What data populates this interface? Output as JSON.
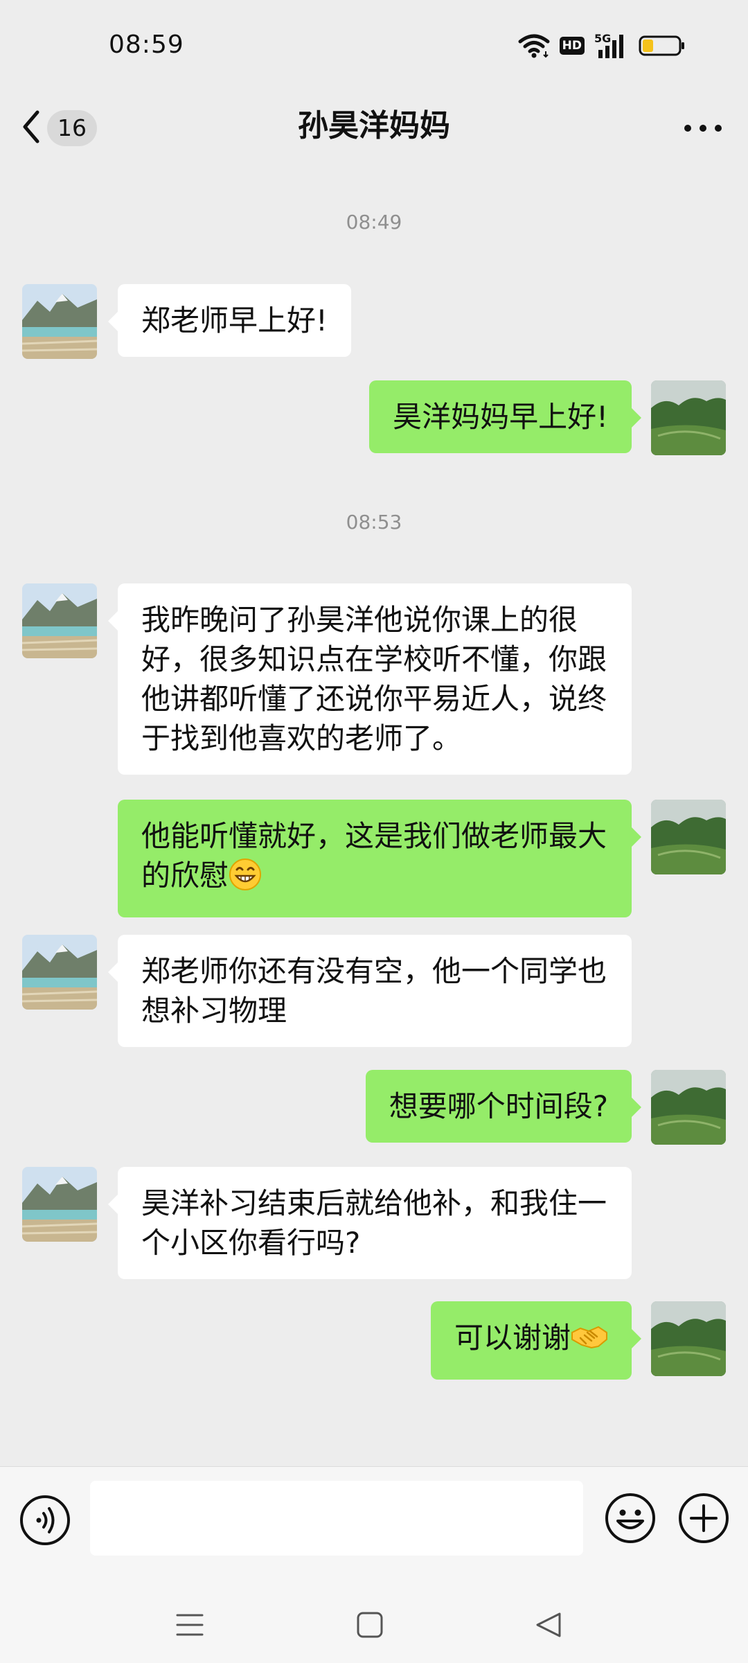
{
  "status_bar": {
    "time": "08:59",
    "icons": [
      "wifi-icon",
      "hd-icon",
      "signal-5g-icon",
      "battery-icon"
    ],
    "network_label": "5G",
    "hd_label": "HD",
    "battery_level": 0.3
  },
  "header": {
    "back_count": "16",
    "title": "孙昊洋妈妈"
  },
  "messages": [
    {
      "type": "timestamp",
      "text": "08:49"
    },
    {
      "type": "in",
      "text": "郑老师早上好!"
    },
    {
      "type": "out",
      "text": "昊洋妈妈早上好!"
    },
    {
      "type": "timestamp",
      "text": "08:53"
    },
    {
      "type": "in",
      "text": "我昨晚问了孙昊洋他说你课上的很好，很多知识点在学校听不懂，你跟他讲都听懂了还说你平易近人，说终于找到他喜欢的老师了。"
    },
    {
      "type": "out",
      "text": "他能听懂就好，这是我们做老师最大的欣慰",
      "emoji": "grinning-face-emoji"
    },
    {
      "type": "in",
      "text": "郑老师你还有没有空，他一个同学也想补习物理"
    },
    {
      "type": "out",
      "text": "想要哪个时间段?"
    },
    {
      "type": "in",
      "text": "昊洋补习结束后就给他补，和我住一个小区你看行吗?"
    },
    {
      "type": "out",
      "text": "可以谢谢",
      "emoji": "handshake-emoji"
    }
  ],
  "input_bar": {
    "placeholder": "",
    "icons": [
      "voice-icon",
      "emoji-icon",
      "plus-icon"
    ]
  },
  "system_nav": {
    "icons": [
      "menu-icon",
      "home-icon",
      "back-triangle-icon"
    ]
  },
  "colors": {
    "background": "#ededed",
    "outgoing_bubble": "#95ec69",
    "incoming_bubble": "#ffffff",
    "timestamp": "#8f8f8f"
  }
}
